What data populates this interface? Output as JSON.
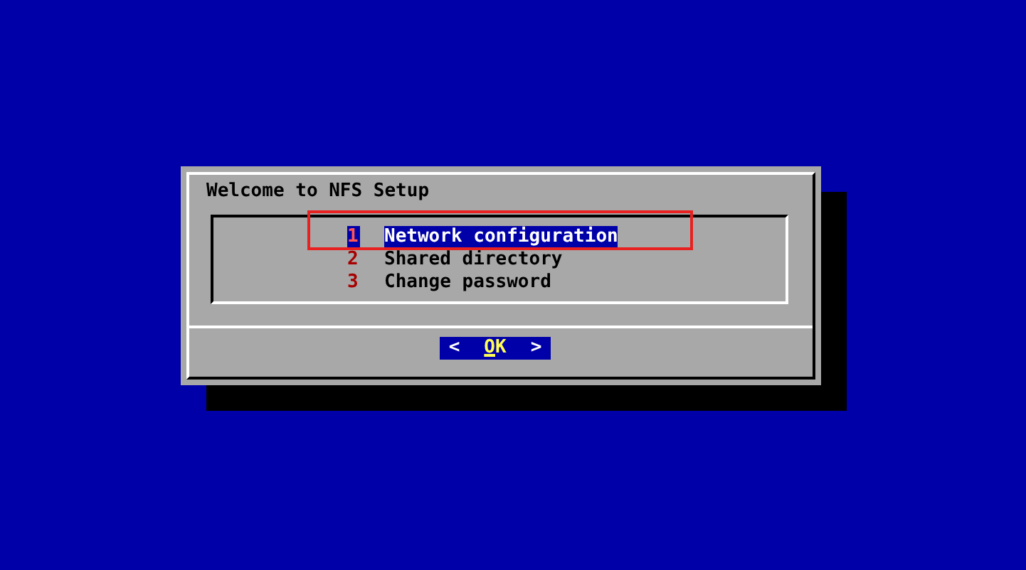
{
  "dialog": {
    "title": "Welcome to NFS Setup",
    "menu": [
      {
        "number": "1",
        "label": "Network configuration",
        "selected": true
      },
      {
        "number": "2",
        "label": "Shared directory",
        "selected": false
      },
      {
        "number": "3",
        "label": "Change password",
        "selected": false
      }
    ],
    "button": {
      "left": "<",
      "label": "OK",
      "right": ">",
      "selected": true
    }
  }
}
